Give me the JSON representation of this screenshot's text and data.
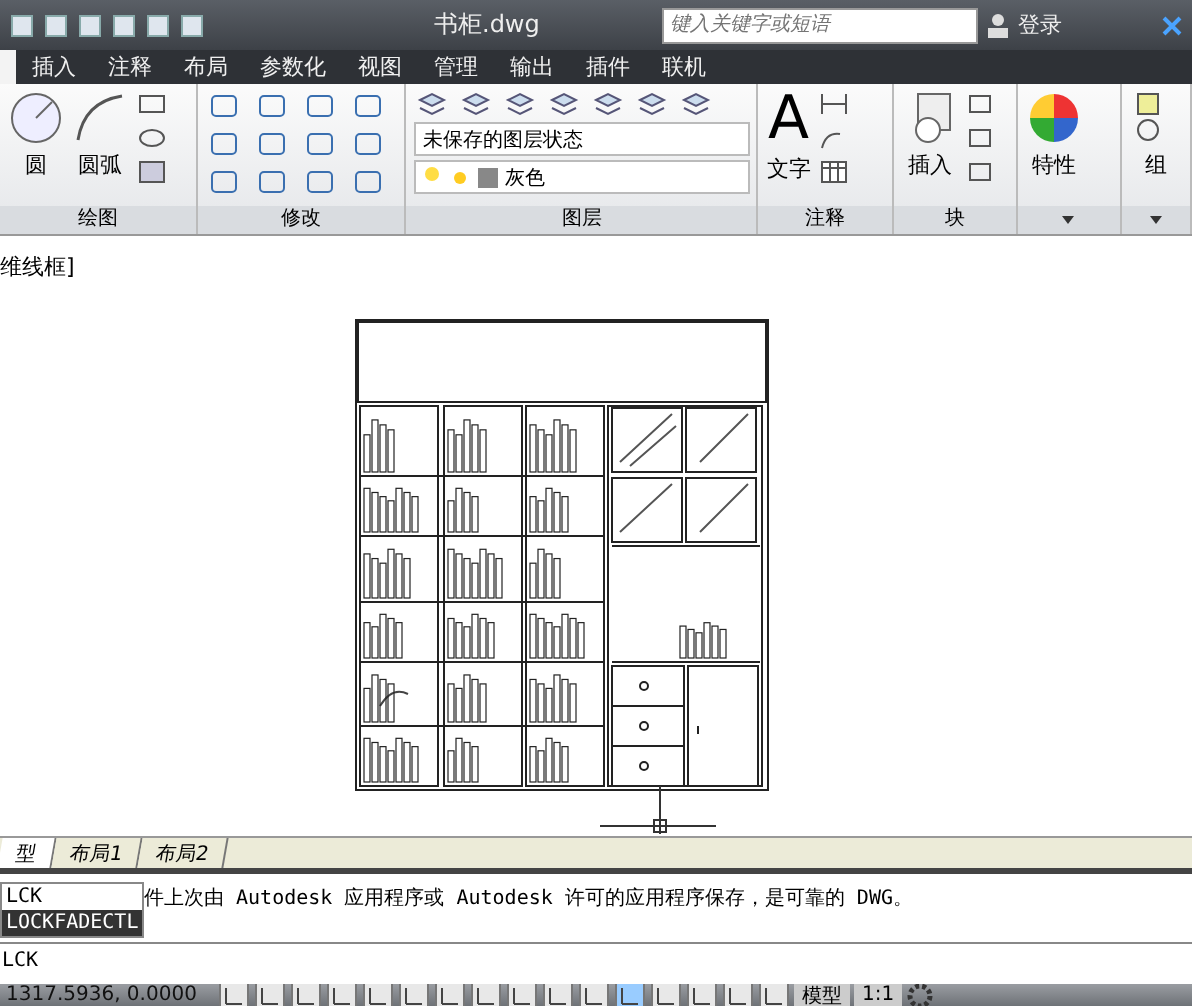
{
  "window": {
    "title": "书柜.dwg",
    "search": {
      "placeholder": "键入关键字或短语"
    },
    "login": "登录"
  },
  "ribbon_tabs": [
    {
      "label": "插入",
      "selected": false
    },
    {
      "label": "注释",
      "selected": false
    },
    {
      "label": "布局",
      "selected": false
    },
    {
      "label": "参数化",
      "selected": false
    },
    {
      "label": "视图",
      "selected": false
    },
    {
      "label": "管理",
      "selected": false
    },
    {
      "label": "输出",
      "selected": false
    },
    {
      "label": "插件",
      "selected": false
    },
    {
      "label": "联机",
      "selected": false
    }
  ],
  "panels": {
    "draw": {
      "title": "绘图",
      "circle": "圆",
      "arc": "圆弧"
    },
    "modify": {
      "title": "修改"
    },
    "layers": {
      "title": "图层",
      "layer_state": "未保存的图层状态",
      "layer": "灰色"
    },
    "annotation": {
      "title": "注释",
      "text": "文字",
      "text_glyph": "A"
    },
    "block": {
      "title": "块",
      "insert": "插入"
    },
    "properties": {
      "title": "特性"
    },
    "groups": {
      "title": "组"
    }
  },
  "viewport": {
    "label": "维线框]"
  },
  "layout_tabs": [
    {
      "label": "型",
      "selected": true
    },
    {
      "label": "布局1",
      "selected": false
    },
    {
      "label": "布局2",
      "selected": false
    }
  ],
  "command": {
    "history": "件上次由 Autodesk 应用程序或 Autodesk 许可的应用程序保存，是可靠的 DWG。",
    "suggestions": [
      {
        "label": "LCK",
        "selected": false
      },
      {
        "label": "LOCKFADECTL",
        "selected": true
      }
    ],
    "input": "LCK"
  },
  "status_bar": {
    "coordinates": "1317.5936, 0.0000",
    "space": "模型",
    "scale": "1:1"
  }
}
